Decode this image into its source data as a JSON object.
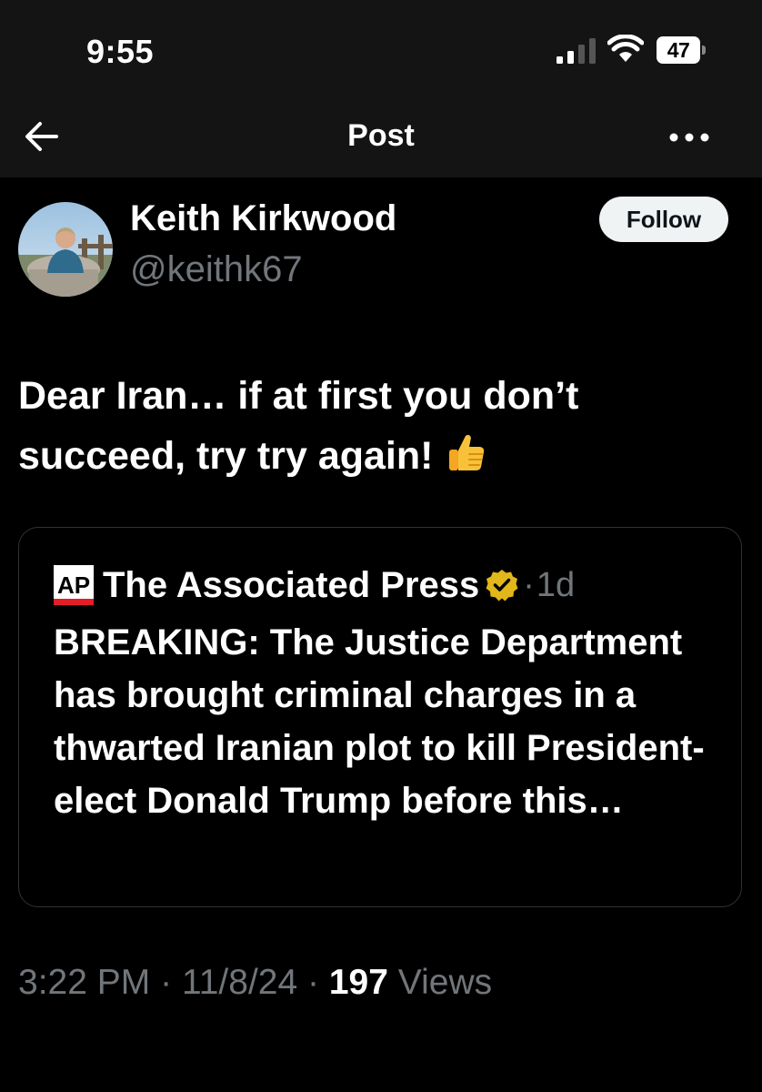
{
  "status_bar": {
    "time": "9:55",
    "battery_level": "47",
    "icons": [
      "signal-icon",
      "wifi-icon",
      "battery-icon"
    ]
  },
  "nav": {
    "title": "Post",
    "icons": [
      "back-arrow-icon",
      "more-options-icon"
    ]
  },
  "author": {
    "name": "Keith Kirkwood",
    "handle": "@keithk67",
    "follow_label": "Follow"
  },
  "post": {
    "text": "Dear Iran… if at first you don’t succeed, try try again!",
    "emoji": "thumbs-up-emoji"
  },
  "quote": {
    "author": "The Associated Press",
    "dot": "·",
    "time": "1d",
    "text": "BREAKING: The Justice Department has brought criminal charges in a thwarted Iranian plot to kill President-elect Donald Trump before this…",
    "logo": "ap-logo",
    "verified_icon": "verified-gold-badge-icon"
  },
  "meta": {
    "time": "3:22 PM",
    "sep": "·",
    "date": "11/8/24",
    "views_count": "197",
    "views_label": "Views"
  },
  "colors": {
    "background": "#000000",
    "header_background": "#141414",
    "text_primary": "#ffffff",
    "text_secondary": "#71767b",
    "border": "#2f3336",
    "follow_bg": "#eff3f4",
    "verified_gold": "#e2b719",
    "ap_red": "#e31e26"
  }
}
